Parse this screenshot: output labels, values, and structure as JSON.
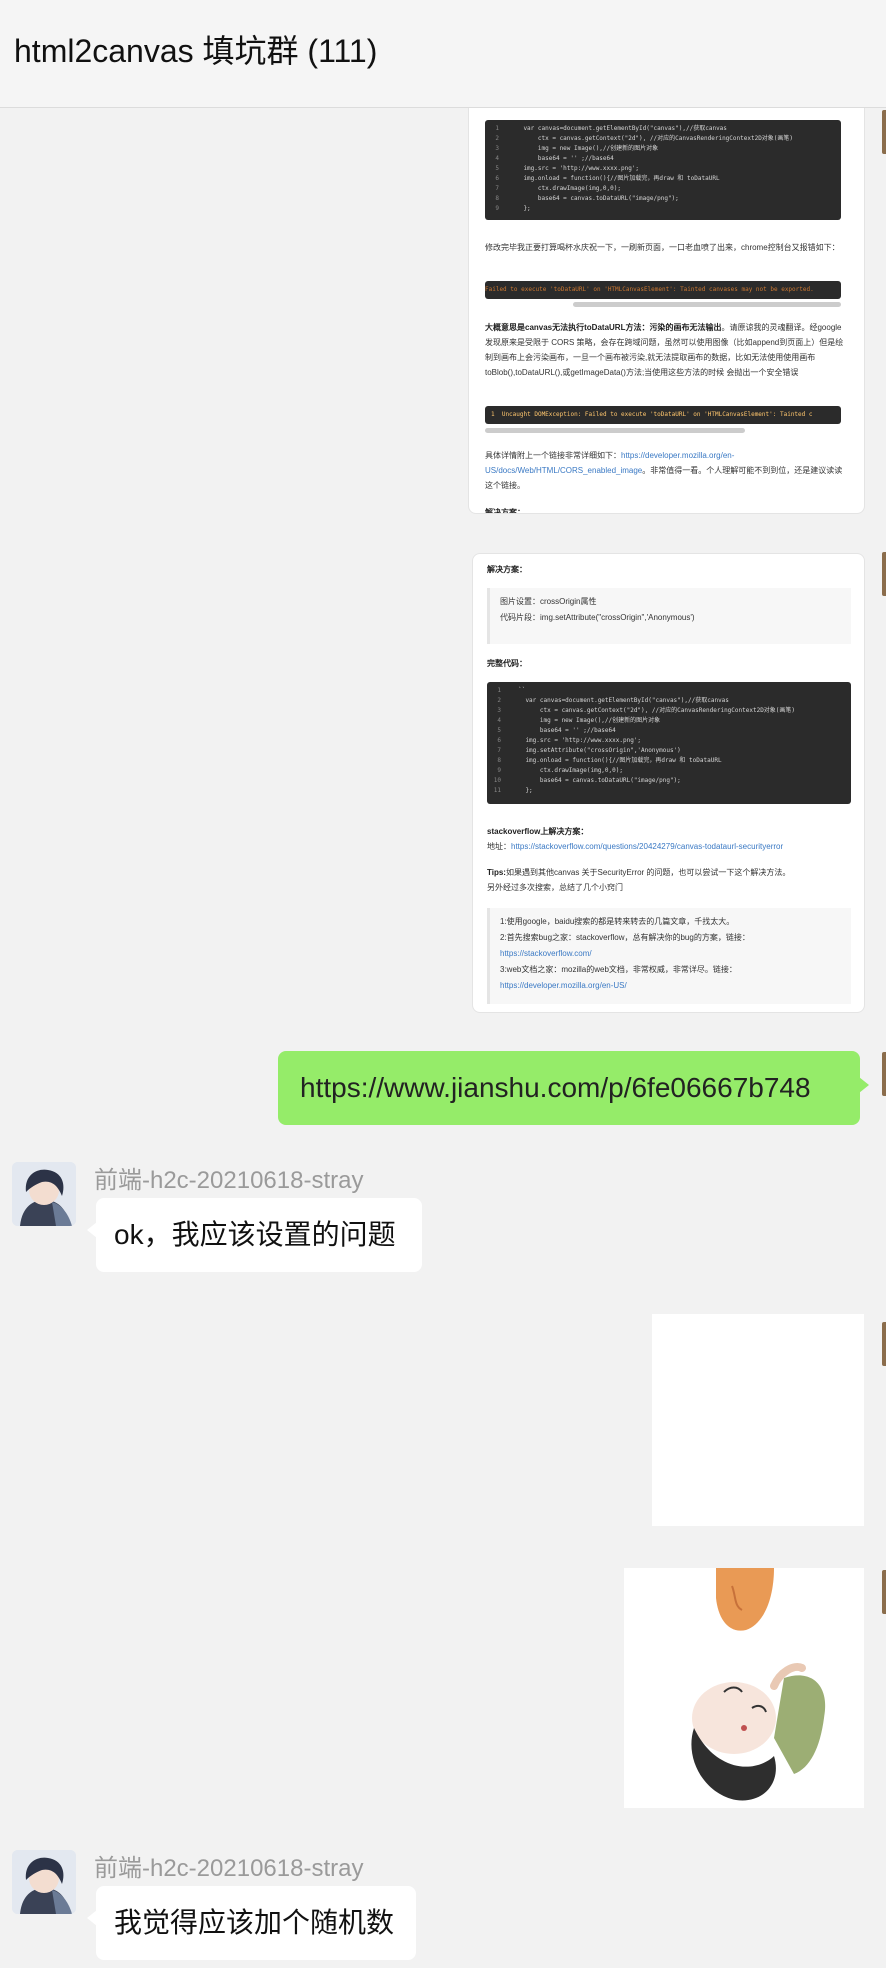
{
  "header": {
    "title": "html2canvas 填坑群 (111)"
  },
  "card1": {
    "code_lines": [
      [
        "1",
        "    var canvas=document.getElementById(\"canvas\"),//获取canvas"
      ],
      [
        "2",
        "        ctx = canvas.getContext(\"2d\"), //对应的CanvasRenderingContext2D对象(画笔)"
      ],
      [
        "3",
        "        img = new Image(),//创建新的图片对象"
      ],
      [
        "4",
        "        base64 = '' ;//base64"
      ],
      [
        "5",
        "    img.src = 'http://www.xxxx.png';"
      ],
      [
        "6",
        "    img.onload = function(){//图片加载完，再draw 和 toDataURL"
      ],
      [
        "7",
        "        ctx.drawImage(img,0,0);"
      ],
      [
        "8",
        "        base64 = canvas.toDataURL(\"image/png\");"
      ],
      [
        "9",
        "    };"
      ]
    ],
    "para1": "修改完毕我正要打算喝杯水庆祝一下，一刷新页面，一口老血喷了出来，chrome控制台又报错如下：",
    "error1": "Failed to execute 'toDataURL' on 'HTMLCanvasElement': Tainted canvases may not be exported.",
    "para2_bold": "大概意思是canvas无法执行toDataURL方法：污染的画布无法输出",
    "para2_rest": "。请原谅我的灵魂翻译。经google 发现原来是受限于 CORS 策略，会存在跨域问题，虽然可以使用图像（比如append到页面上）但是绘制到画布上会污染画布，一旦一个画布被污染,就无法提取画布的数据，比如无法使用使用画布toBlob(),toDataURL(),或getImageData()方法;当使用这些方法的时候 会抛出一个安全错误",
    "error2": "1  Uncaught DOMException: Failed to execute 'toDataURL' on 'HTMLCanvasElement': Tainted c",
    "para3_start": "具体详情附上一个链接非常详细如下：",
    "para3_link": "https://developer.mozilla.org/en-US/docs/Web/HTML/CORS_enabled_image",
    "para3_end": "。非常值得一看。个人理解可能不到到位，还是建议读读这个链接。",
    "cut_heading": "解决方案："
  },
  "card2": {
    "heading1": "解决方案：",
    "quote_line1": "图片设置：crossOrigin属性",
    "quote_line2": "代码片段：img.setAttribute(\"crossOrigin\",'Anonymous')",
    "heading2": "完整代码：",
    "code_lines": [
      [
        "1",
        "  ``"
      ],
      [
        "2",
        "    var canvas=document.getElementById(\"canvas\"),//获取canvas"
      ],
      [
        "3",
        "        ctx = canvas.getContext(\"2d\"), //对应的CanvasRenderingContext2D对象(画笔)"
      ],
      [
        "4",
        "        img = new Image(),//创建新的图片对象"
      ],
      [
        "5",
        "        base64 = '' ;//base64"
      ],
      [
        "6",
        "    img.src = 'http://www.xxxx.png';"
      ],
      [
        "7",
        "    img.setAttribute(\"crossOrigin\",'Anonymous')"
      ],
      [
        "8",
        "    img.onload = function(){//图片加载完，再draw 和 toDataURL"
      ],
      [
        "9",
        "        ctx.drawImage(img,0,0);"
      ],
      [
        "10",
        "        base64 = canvas.toDataURL(\"image/png\");"
      ],
      [
        "11",
        "    };"
      ]
    ],
    "so_heading": "stackoverflow上解决方案：",
    "so_label": "地址：",
    "so_link": "https://stackoverflow.com/questions/20424279/canvas-todataurl-securityerror",
    "tips_bold": "Tips:",
    "tips_line1": "如果遇到其他canvas 关于SecurityError 的问题，也可以尝试一下这个解决方法。",
    "tips_line2": "另外经过多次搜索，总结了几个小窍门",
    "q_line1": "1:使用google，baidu搜索的都是转来转去的几篇文章，千找太大。",
    "q_line2": "2:首先搜索bug之家：stackoverflow，总有解决你的bug的方案，链接：",
    "q_link2": "https://stackoverflow.com/",
    "q_line3": "3:web文档之家：mozilla的web文档，非常权威，非常详尽。链接：",
    "q_link3": "https://developer.mozilla.org/en-US/"
  },
  "messages": {
    "link_message": "https://www.jianshu.com/p/6fe06667b748",
    "sender1": "前端-h2c-20210618-stray",
    "reply1": "ok，我应该设置的问题",
    "sender2": "前端-h2c-20210618-stray",
    "reply2": "我觉得应该加个随机数"
  }
}
